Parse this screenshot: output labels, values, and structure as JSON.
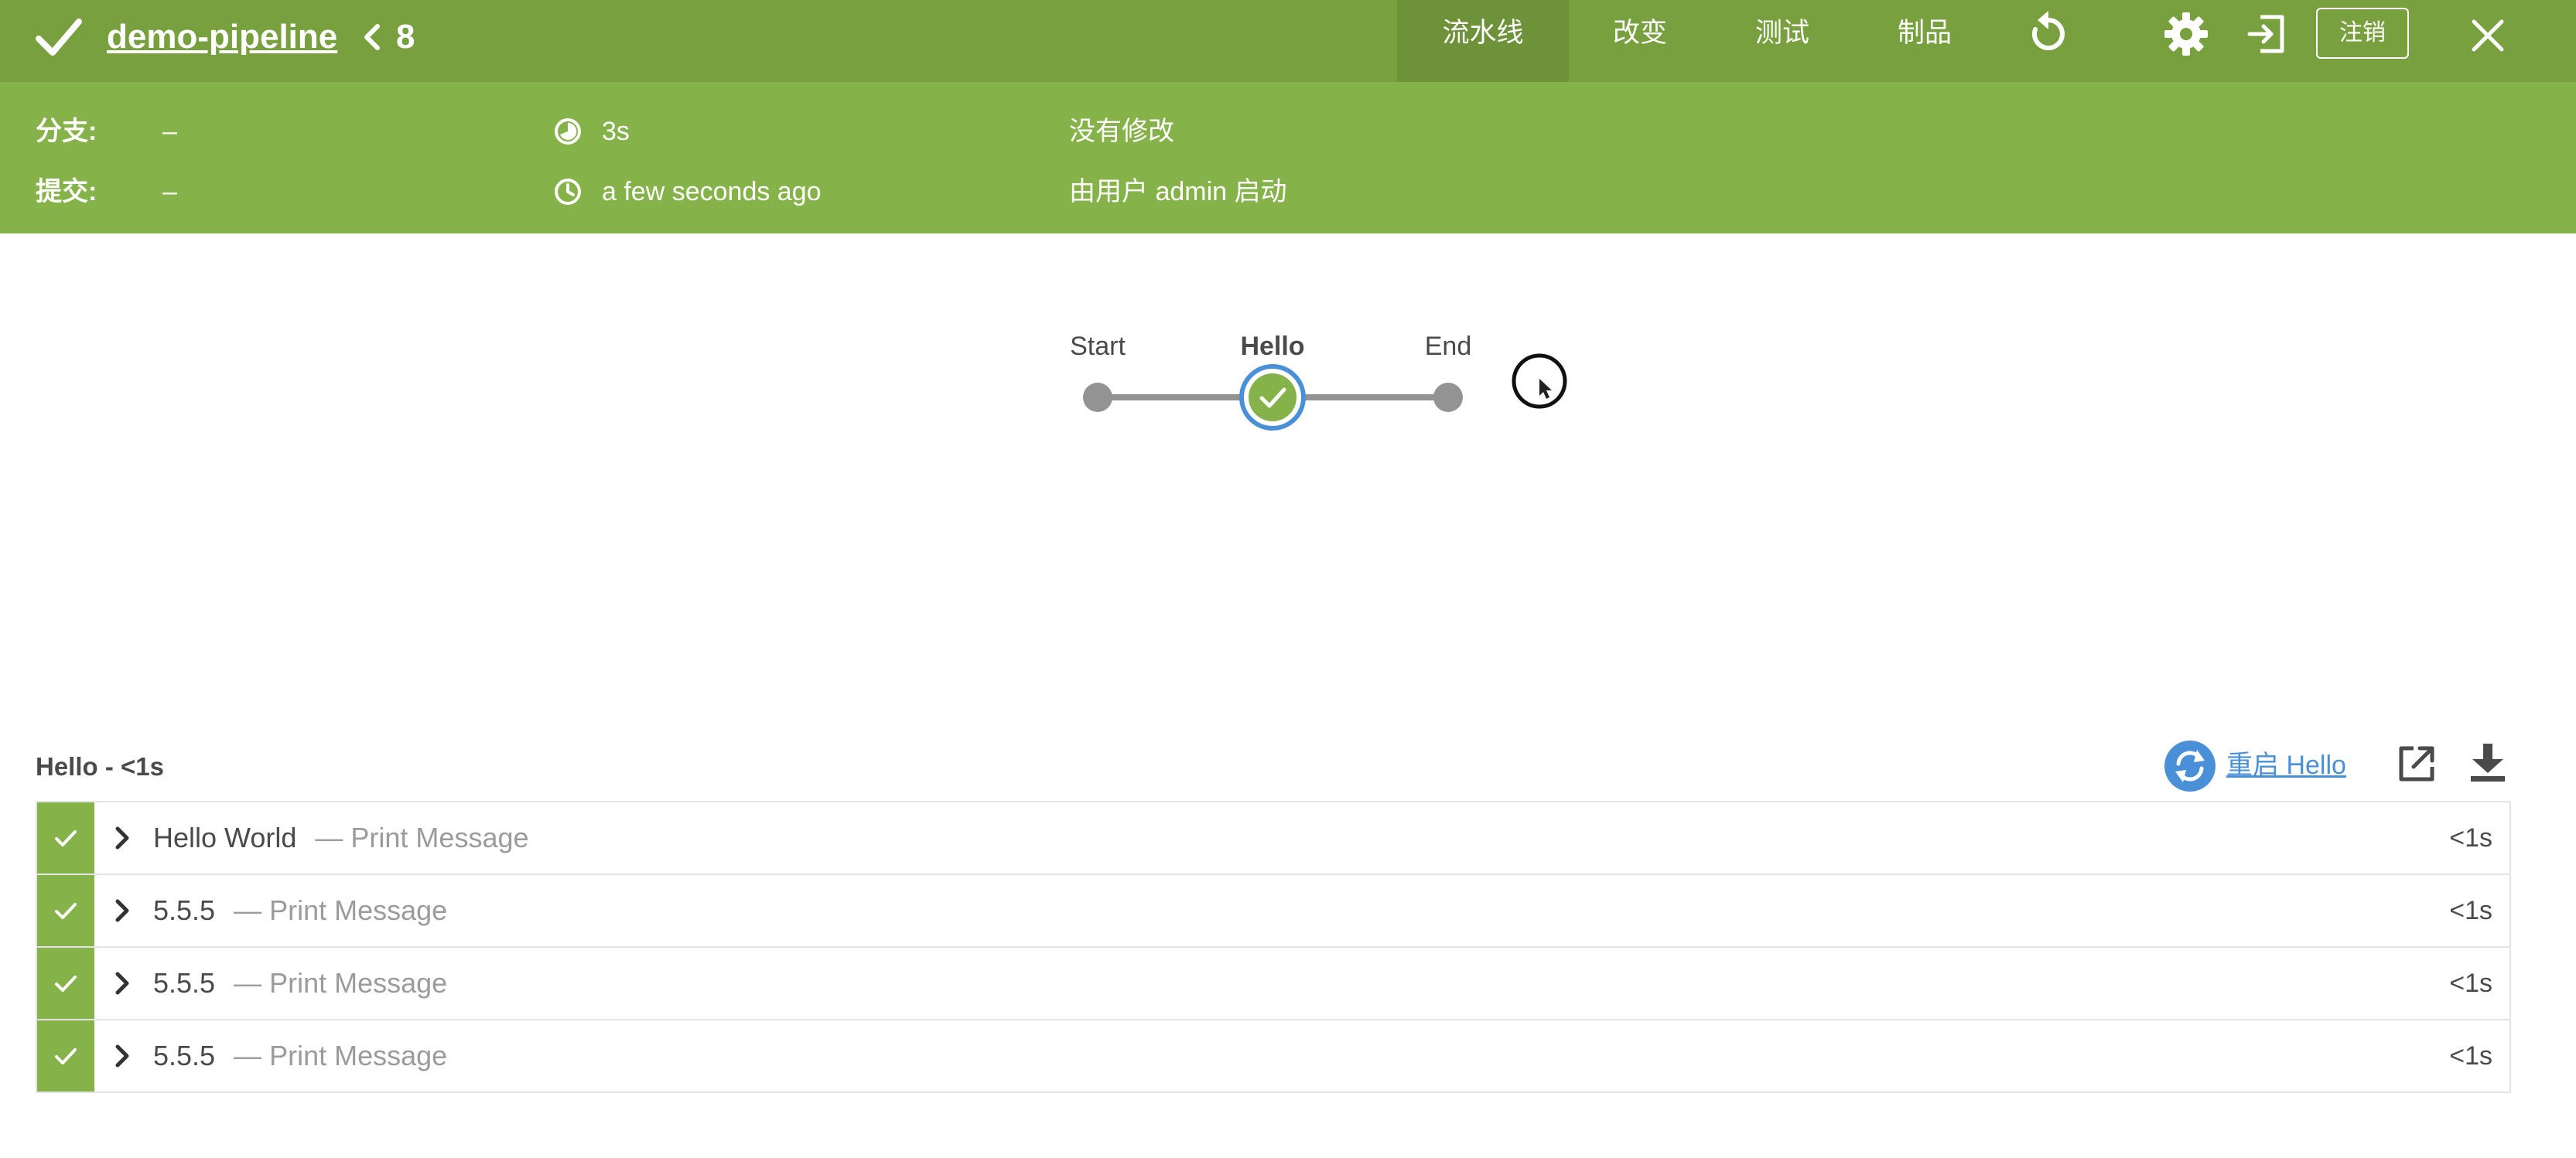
{
  "header": {
    "job_name": "demo-pipeline",
    "run_number": "8",
    "tabs": [
      {
        "label": "流水线",
        "active": true
      },
      {
        "label": "改变",
        "active": false
      },
      {
        "label": "测试",
        "active": false
      },
      {
        "label": "制品",
        "active": false
      }
    ],
    "logout_label": "注销",
    "icons": [
      "check-icon",
      "back-icon",
      "rerun-icon",
      "settings-icon",
      "exit-icon",
      "close-icon"
    ],
    "colors": {
      "topbar": "#78a03e",
      "infobar": "#86b24a",
      "link": "#4a90d9"
    }
  },
  "info": {
    "branch_label": "分支:",
    "branch_value": "–",
    "commit_label": "提交:",
    "commit_value": "–",
    "duration": "3s",
    "time_ago": "a few seconds ago",
    "changes": "没有修改",
    "started_by": "由用户 admin 启动"
  },
  "graph": {
    "stages": [
      {
        "name": "Start",
        "status": "done"
      },
      {
        "name": "Hello",
        "status": "success",
        "selected": true
      },
      {
        "name": "End",
        "status": "done"
      }
    ]
  },
  "stage_detail": {
    "title": "Hello - <1s",
    "restart_label": "重启 Hello",
    "steps": [
      {
        "name": "Hello World",
        "desc": "— Print Message",
        "duration": "<1s",
        "status": "success"
      },
      {
        "name": "5.5.5",
        "desc": "— Print Message",
        "duration": "<1s",
        "status": "success"
      },
      {
        "name": "5.5.5",
        "desc": "— Print Message",
        "duration": "<1s",
        "status": "success"
      },
      {
        "name": "5.5.5",
        "desc": "— Print Message",
        "duration": "<1s",
        "status": "success"
      }
    ]
  }
}
